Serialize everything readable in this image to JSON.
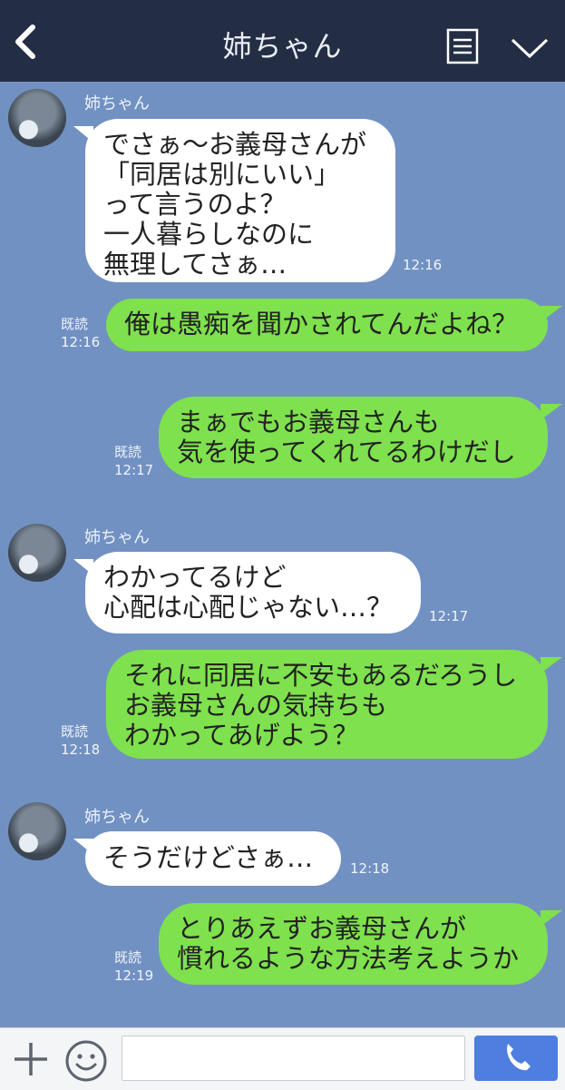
{
  "header": {
    "title": "姉ちゃん",
    "back_icon": "chevron-left-icon",
    "menu_icon": "list-icon",
    "chevron_icon": "chevron-down-icon",
    "bg_color": "#232e45"
  },
  "chat": {
    "bg_color": "#7191c3",
    "messages": [
      {
        "from": "姉ちゃん",
        "side": "left",
        "text": "でさぁ〜お義母さんが\n「同居は別にいい」\nって言うのよ？\n一人暮らしなのに\n無理してさぁ…",
        "time": "12:16"
      },
      {
        "from": "me",
        "side": "right",
        "text": "俺は愚痴を聞かされてんだよね？",
        "read": "既読",
        "time": "12:16"
      },
      {
        "from": "me",
        "side": "right",
        "text": "まぁでもお義母さんも\n気を使ってくれてるわけだし",
        "read": "既読",
        "time": "12:17"
      },
      {
        "from": "姉ちゃん",
        "side": "left",
        "text": "わかってるけど\n心配は心配じゃない…？",
        "time": "12:17"
      },
      {
        "from": "me",
        "side": "right",
        "text": "それに同居に不安もあるだろうし\nお義母さんの気持ちも\nわかってあげよう？",
        "read": "既読",
        "time": "12:18"
      },
      {
        "from": "姉ちゃん",
        "side": "left",
        "text": "そうだけどさぁ…",
        "time": "12:18"
      },
      {
        "from": "me",
        "side": "right",
        "text": "とりあえずお義母さんが\n慣れるような方法考えようか",
        "read": "既読",
        "time": "12:19"
      }
    ]
  },
  "footer": {
    "plus_icon": "plus-icon",
    "emoji_icon": "smiley-icon",
    "input_value": "",
    "call_icon": "phone-icon",
    "call_color": "#4d7ee0"
  }
}
